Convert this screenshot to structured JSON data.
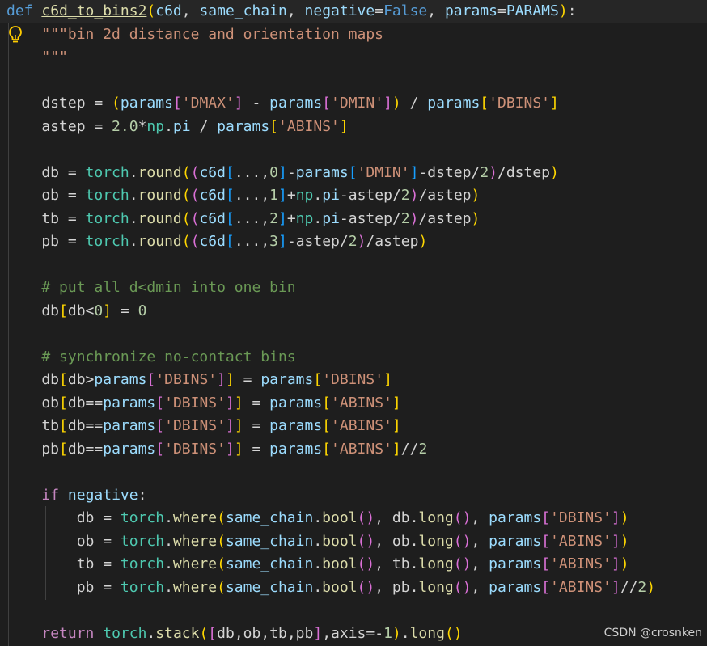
{
  "editor": {
    "language": "python",
    "function_name": "c6d_to_bins2",
    "lines": [
      "def c6d_to_bins2(c6d, same_chain, negative=False, params=PARAMS):",
      "    \"\"\"bin 2d distance and orientation maps",
      "    \"\"\"",
      "",
      "    dstep = (params['DMAX'] - params['DMIN']) / params['DBINS']",
      "    astep = 2.0*np.pi / params['ABINS']",
      "",
      "    db = torch.round((c6d[...,0]-params['DMIN']-dstep/2)/dstep)",
      "    ob = torch.round((c6d[...,1]+np.pi-astep/2)/astep)",
      "    tb = torch.round((c6d[...,2]+np.pi-astep/2)/astep)",
      "    pb = torch.round((c6d[...,3]-astep/2)/astep)",
      "",
      "    # put all d<dmin into one bin",
      "    db[db<0] = 0",
      "",
      "    # synchronize no-contact bins",
      "    db[db>params['DBINS']] = params['DBINS']",
      "    ob[db==params['DBINS']] = params['ABINS']",
      "    tb[db==params['DBINS']] = params['ABINS']",
      "    pb[db==params['DBINS']] = params['ABINS']//2",
      "",
      "    if negative:",
      "        db = torch.where(same_chain.bool(), db.long(), params['DBINS'])",
      "        ob = torch.where(same_chain.bool(), ob.long(), params['ABINS'])",
      "        tb = torch.where(same_chain.bool(), tb.long(), params['ABINS'])",
      "        pb = torch.where(same_chain.bool(), pb.long(), params['ABINS']//2)",
      "",
      "    return torch.stack([db,ob,tb,pb],axis=-1).long()"
    ],
    "lightbulb_icon": "lightbulb-icon",
    "colors": {
      "background": "#1e1e1e",
      "keyword": "#569cd6",
      "control_keyword": "#c586c0",
      "function": "#dcdcaa",
      "parameter": "#9cdcfe",
      "string": "#ce9178",
      "number": "#b5cea8",
      "comment": "#6a9955",
      "bracket_gold": "#ffd700",
      "bracket_orchid": "#da70d6",
      "bracket_blue": "#179fff"
    }
  },
  "watermark": "CSDN @crosnken"
}
